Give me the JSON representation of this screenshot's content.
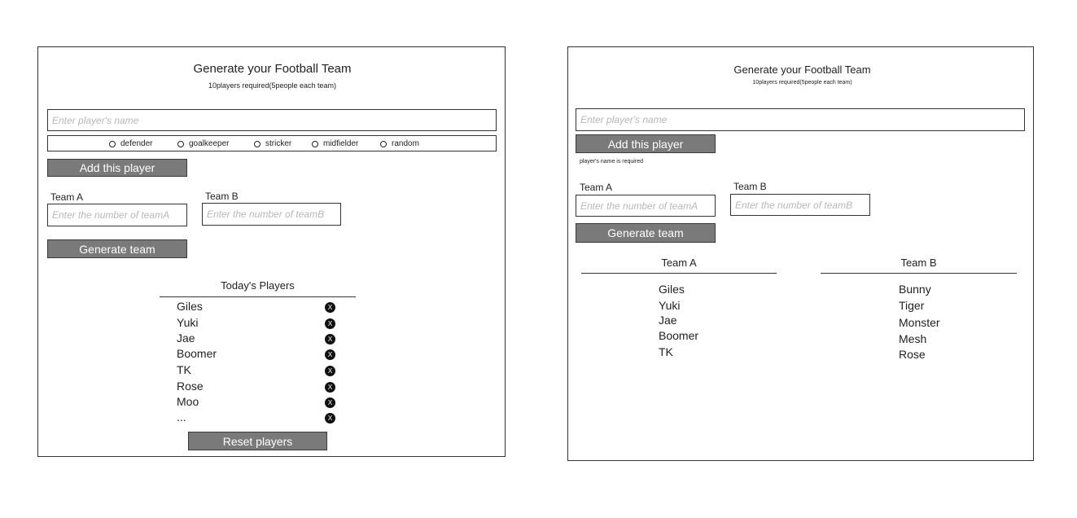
{
  "left": {
    "title": "Generate your Football Team",
    "subtitle": "10players required(5people each team)",
    "name_placeholder": "Enter player's name",
    "positions": [
      "defender",
      "goalkeeper",
      "stricker",
      "midfielder",
      "random"
    ],
    "add_button": "Add this player",
    "team_a_label": "Team A",
    "team_b_label": "Team B",
    "team_a_placeholder": "Enter  the number of teamA",
    "team_b_placeholder": "Enter  the number of teamB",
    "generate_button": "Generate team",
    "players_heading": "Today's Players",
    "players": [
      "Giles",
      "Yuki",
      "Jae",
      "Boomer",
      "TK",
      "Rose",
      "Moo",
      "..."
    ],
    "remove_icon": "X",
    "reset_button": "Reset players"
  },
  "right": {
    "title": "Generate your Football Team",
    "subtitle": "10players required(5people each team)",
    "name_placeholder": "Enter player's name",
    "add_button": "Add this player",
    "error_message": "player's name is required",
    "team_a_label": "Team A",
    "team_b_label": "Team B",
    "team_a_placeholder": "Enter  the number of teamA",
    "team_b_placeholder": "Enter  the number of teamB",
    "generate_button": "Generate team",
    "result_team_a_heading": "Team A",
    "result_team_b_heading": "Team B",
    "team_a_players": [
      "Giles",
      "Yuki",
      "Jae",
      "Boomer",
      "TK"
    ],
    "team_b_players": [
      "Bunny",
      "Tiger",
      "Monster",
      "Mesh",
      "Rose"
    ]
  }
}
